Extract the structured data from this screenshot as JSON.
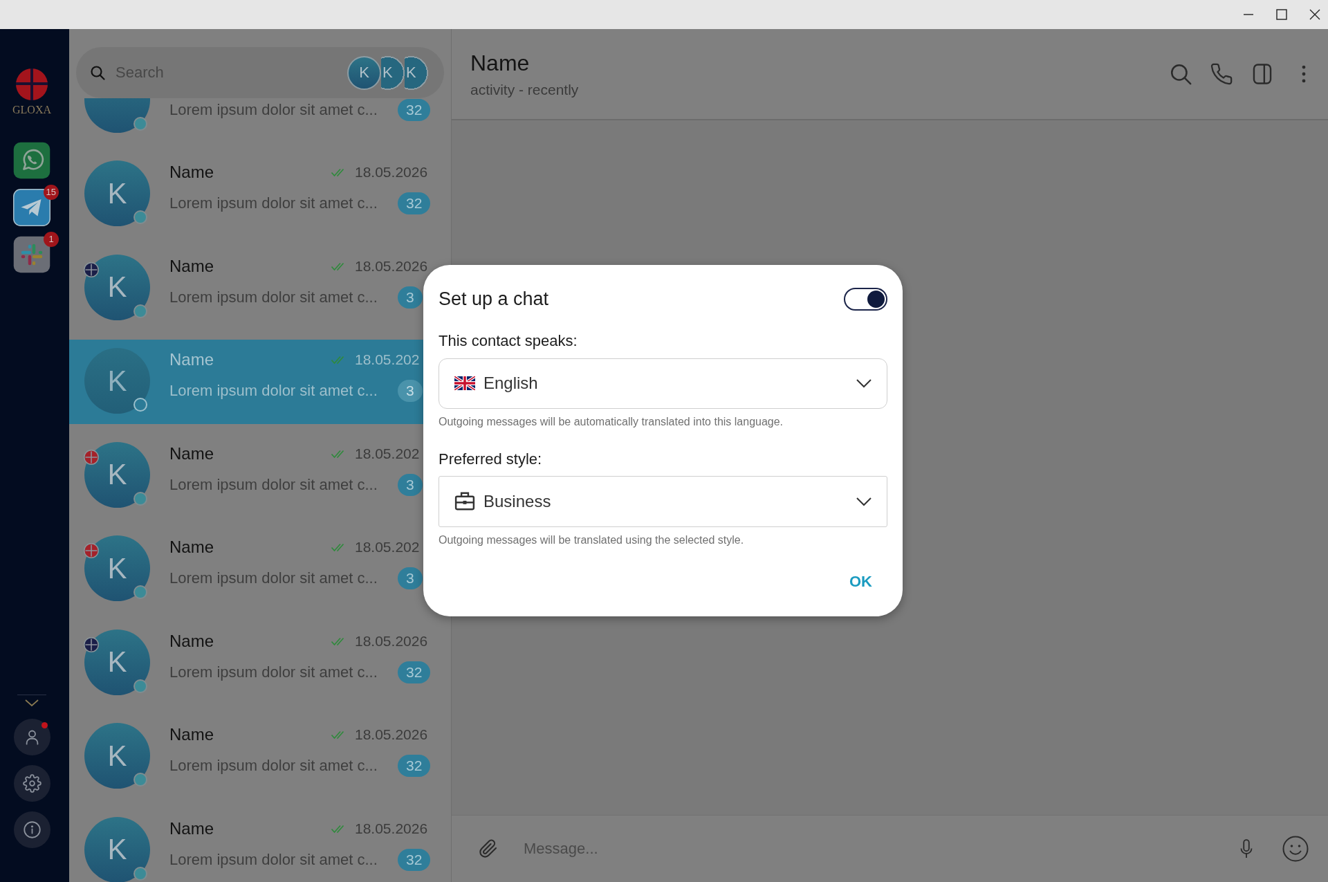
{
  "sidebar": {
    "logo_text": "GLOXA",
    "apps": [
      {
        "kind": "phone-bubble",
        "selected": false
      },
      {
        "kind": "paper-plane",
        "selected": true,
        "badge": "15"
      },
      {
        "kind": "hash",
        "selected": false,
        "badge": "1"
      }
    ],
    "bottom_buttons": [
      {
        "kind": "profile",
        "alert": true
      },
      {
        "kind": "settings",
        "alert": false
      },
      {
        "kind": "info",
        "alert": false
      }
    ]
  },
  "search": {
    "placeholder": "Search",
    "filters": [
      "K",
      "K",
      "K"
    ]
  },
  "chats": [
    {
      "preview": "Lorem ipsum dolor sit amet c...",
      "unread": "32",
      "selected": false
    },
    {
      "initial": "K",
      "name": "Name",
      "read": true,
      "date": "18.05.2026",
      "preview": "Lorem ipsum dolor sit amet c...",
      "unread": "32",
      "selected": false
    },
    {
      "initial": "K",
      "name": "Name",
      "read": true,
      "date": "18.05.2026",
      "preview": "Lorem ipsum dolor sit amet c...",
      "unread": "3",
      "selected": false,
      "tag": {
        "color": "#1b1f48"
      }
    },
    {
      "initial": "K",
      "name": "Name",
      "read": true,
      "date": "18.05.202",
      "preview": "Lorem ipsum dolor sit amet c...",
      "unread": "3",
      "selected": true
    },
    {
      "initial": "K",
      "name": "Name",
      "read": true,
      "date": "18.05.202",
      "preview": "Lorem ipsum dolor sit amet c...",
      "unread": "3",
      "selected": false,
      "tag": {
        "color": "#a4222a"
      }
    },
    {
      "initial": "K",
      "name": "Name",
      "read": true,
      "date": "18.05.202",
      "preview": "Lorem ipsum dolor sit amet c...",
      "unread": "3",
      "selected": false,
      "tag": {
        "color": "#a4222a"
      }
    },
    {
      "initial": "K",
      "name": "Name",
      "read": true,
      "date": "18.05.2026",
      "preview": "Lorem ipsum dolor sit amet c...",
      "unread": "32",
      "selected": false,
      "tag": {
        "color": "#1b1f48"
      }
    },
    {
      "initial": "K",
      "name": "Name",
      "read": true,
      "date": "18.05.2026",
      "preview": "Lorem ipsum dolor sit amet c...",
      "unread": "32",
      "selected": false
    },
    {
      "initial": "K",
      "name": "Name",
      "read": true,
      "date": "18.05.2026",
      "preview": "Lorem ipsum dolor sit amet c...",
      "unread": "32",
      "selected": false
    }
  ],
  "conversation": {
    "title": "Name",
    "status": "activity - recently"
  },
  "composer": {
    "placeholder": "Message..."
  },
  "dialog": {
    "title": "Set up a chat",
    "enabled": true,
    "language_label": "This contact speaks:",
    "language": "English",
    "language_hint": "Outgoing messages will be automatically translated into this language.",
    "style_label": "Preferred style:",
    "style": "Business",
    "style_hint": "Outgoing messages will be translated using the selected style.",
    "confirm": "OK"
  }
}
